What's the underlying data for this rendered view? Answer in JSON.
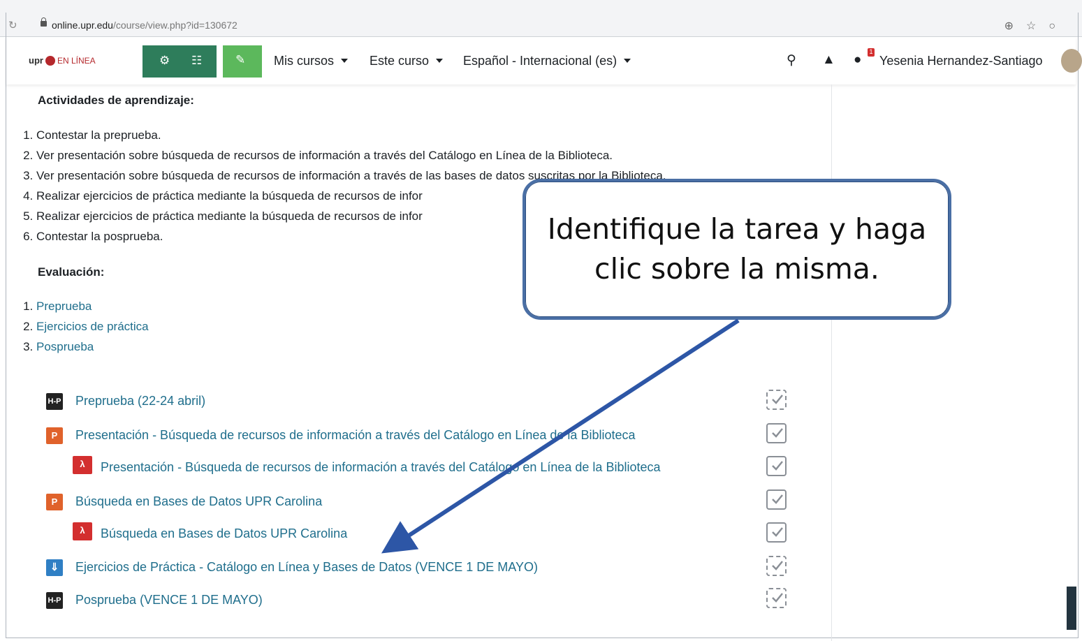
{
  "browser": {
    "url_host": "online.upr.edu",
    "url_path": "/course/view.php?id=130672"
  },
  "navbar": {
    "logo_text": "upr",
    "logo_sub": "EN LÍNEA",
    "menus": [
      "Mis cursos",
      "Este curso",
      "Español - Internacional (es)"
    ],
    "notification_count": "1",
    "user_name": "Yesenia Hernandez-Santiago"
  },
  "content": {
    "activities_heading": "Actividades de aprendizaje:",
    "activities": [
      "Contestar la preprueba.",
      "Ver presentación sobre búsqueda de recursos de información a través del Catálogo en Línea de la Biblioteca.",
      "Ver presentación sobre búsqueda de recursos de información a través de las bases de datos suscritas por la Biblioteca.",
      "Realizar ejercicios de práctica mediante la búsqueda de recursos de infor",
      "Realizar ejercicios de práctica mediante la búsqueda de recursos de infor",
      "Contestar la posprueba."
    ],
    "evaluation_heading": "Evaluación:",
    "evaluation": [
      "Preprueba",
      "Ejercicios de práctica",
      "Posprueba"
    ],
    "course_items": [
      {
        "icon": "h5p-icon",
        "label": "Preprueba (22-24 abril)",
        "status": "dashed"
      },
      {
        "icon": "powerpoint-icon",
        "label": "Presentación - Búsqueda de recursos de información a través del Catálogo en Línea de la Biblioteca",
        "status": "solid"
      },
      {
        "icon": "pdf-icon",
        "label": "Presentación - Búsqueda de recursos de información a través del Catálogo en Línea de la Biblioteca",
        "status": "solid"
      },
      {
        "icon": "powerpoint-icon",
        "label": "Búsqueda en Bases de Datos UPR Carolina",
        "status": "solid"
      },
      {
        "icon": "pdf-icon",
        "label": "Búsqueda en Bases de Datos UPR Carolina",
        "status": "solid"
      },
      {
        "icon": "assignment-icon",
        "label": "Ejercicios de Práctica - Catálogo en Línea y Bases de Datos (VENCE 1 DE MAYO)",
        "status": "dashed"
      },
      {
        "icon": "h5p-icon",
        "label": "Posprueba (VENCE 1 DE MAYO)",
        "status": "dashed"
      }
    ]
  },
  "callout": {
    "line1": "Identifique la tarea y haga",
    "line2": "clic sobre la misma."
  },
  "colors": {
    "link": "#1f6e8c",
    "nav_dark_green": "#2e7d5b",
    "nav_green": "#5cb85c",
    "callout_border": "#4a6fa5",
    "ppt_orange": "#e0622b",
    "pdf_red": "#d32f2f",
    "assign_blue": "#2f7fc4"
  }
}
